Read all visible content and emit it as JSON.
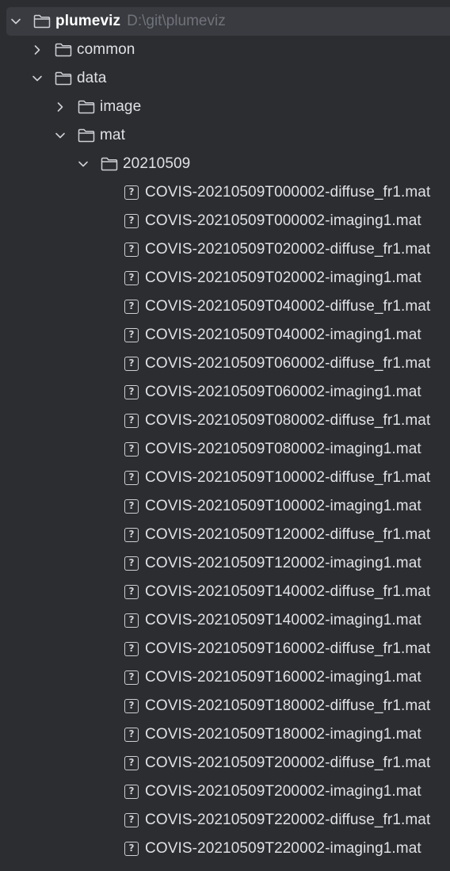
{
  "project": {
    "name": "plumeviz",
    "path": "D:\\git\\plumeviz"
  },
  "tree": {
    "common": "common",
    "data": "data",
    "image": "image",
    "mat": "mat",
    "date_folder": "20210509",
    "files": [
      "COVIS-20210509T000002-diffuse_fr1.mat",
      "COVIS-20210509T000002-imaging1.mat",
      "COVIS-20210509T020002-diffuse_fr1.mat",
      "COVIS-20210509T020002-imaging1.mat",
      "COVIS-20210509T040002-diffuse_fr1.mat",
      "COVIS-20210509T040002-imaging1.mat",
      "COVIS-20210509T060002-diffuse_fr1.mat",
      "COVIS-20210509T060002-imaging1.mat",
      "COVIS-20210509T080002-diffuse_fr1.mat",
      "COVIS-20210509T080002-imaging1.mat",
      "COVIS-20210509T100002-diffuse_fr1.mat",
      "COVIS-20210509T100002-imaging1.mat",
      "COVIS-20210509T120002-diffuse_fr1.mat",
      "COVIS-20210509T120002-imaging1.mat",
      "COVIS-20210509T140002-diffuse_fr1.mat",
      "COVIS-20210509T140002-imaging1.mat",
      "COVIS-20210509T160002-diffuse_fr1.mat",
      "COVIS-20210509T160002-imaging1.mat",
      "COVIS-20210509T180002-diffuse_fr1.mat",
      "COVIS-20210509T180002-imaging1.mat",
      "COVIS-20210509T200002-diffuse_fr1.mat",
      "COVIS-20210509T200002-imaging1.mat",
      "COVIS-20210509T220002-diffuse_fr1.mat",
      "COVIS-20210509T220002-imaging1.mat"
    ],
    "unknown_file_glyph": "?"
  },
  "colors": {
    "background": "#2b2d30",
    "selected_row": "#393b40",
    "text": "#dfe1e5",
    "path_text": "#6f737a",
    "icon": "#ced0d6"
  },
  "icons": {
    "expanded": "chevron-down-icon",
    "collapsed": "chevron-right-icon",
    "folder": "folder-icon",
    "unknown_file": "unknown-file-icon"
  }
}
